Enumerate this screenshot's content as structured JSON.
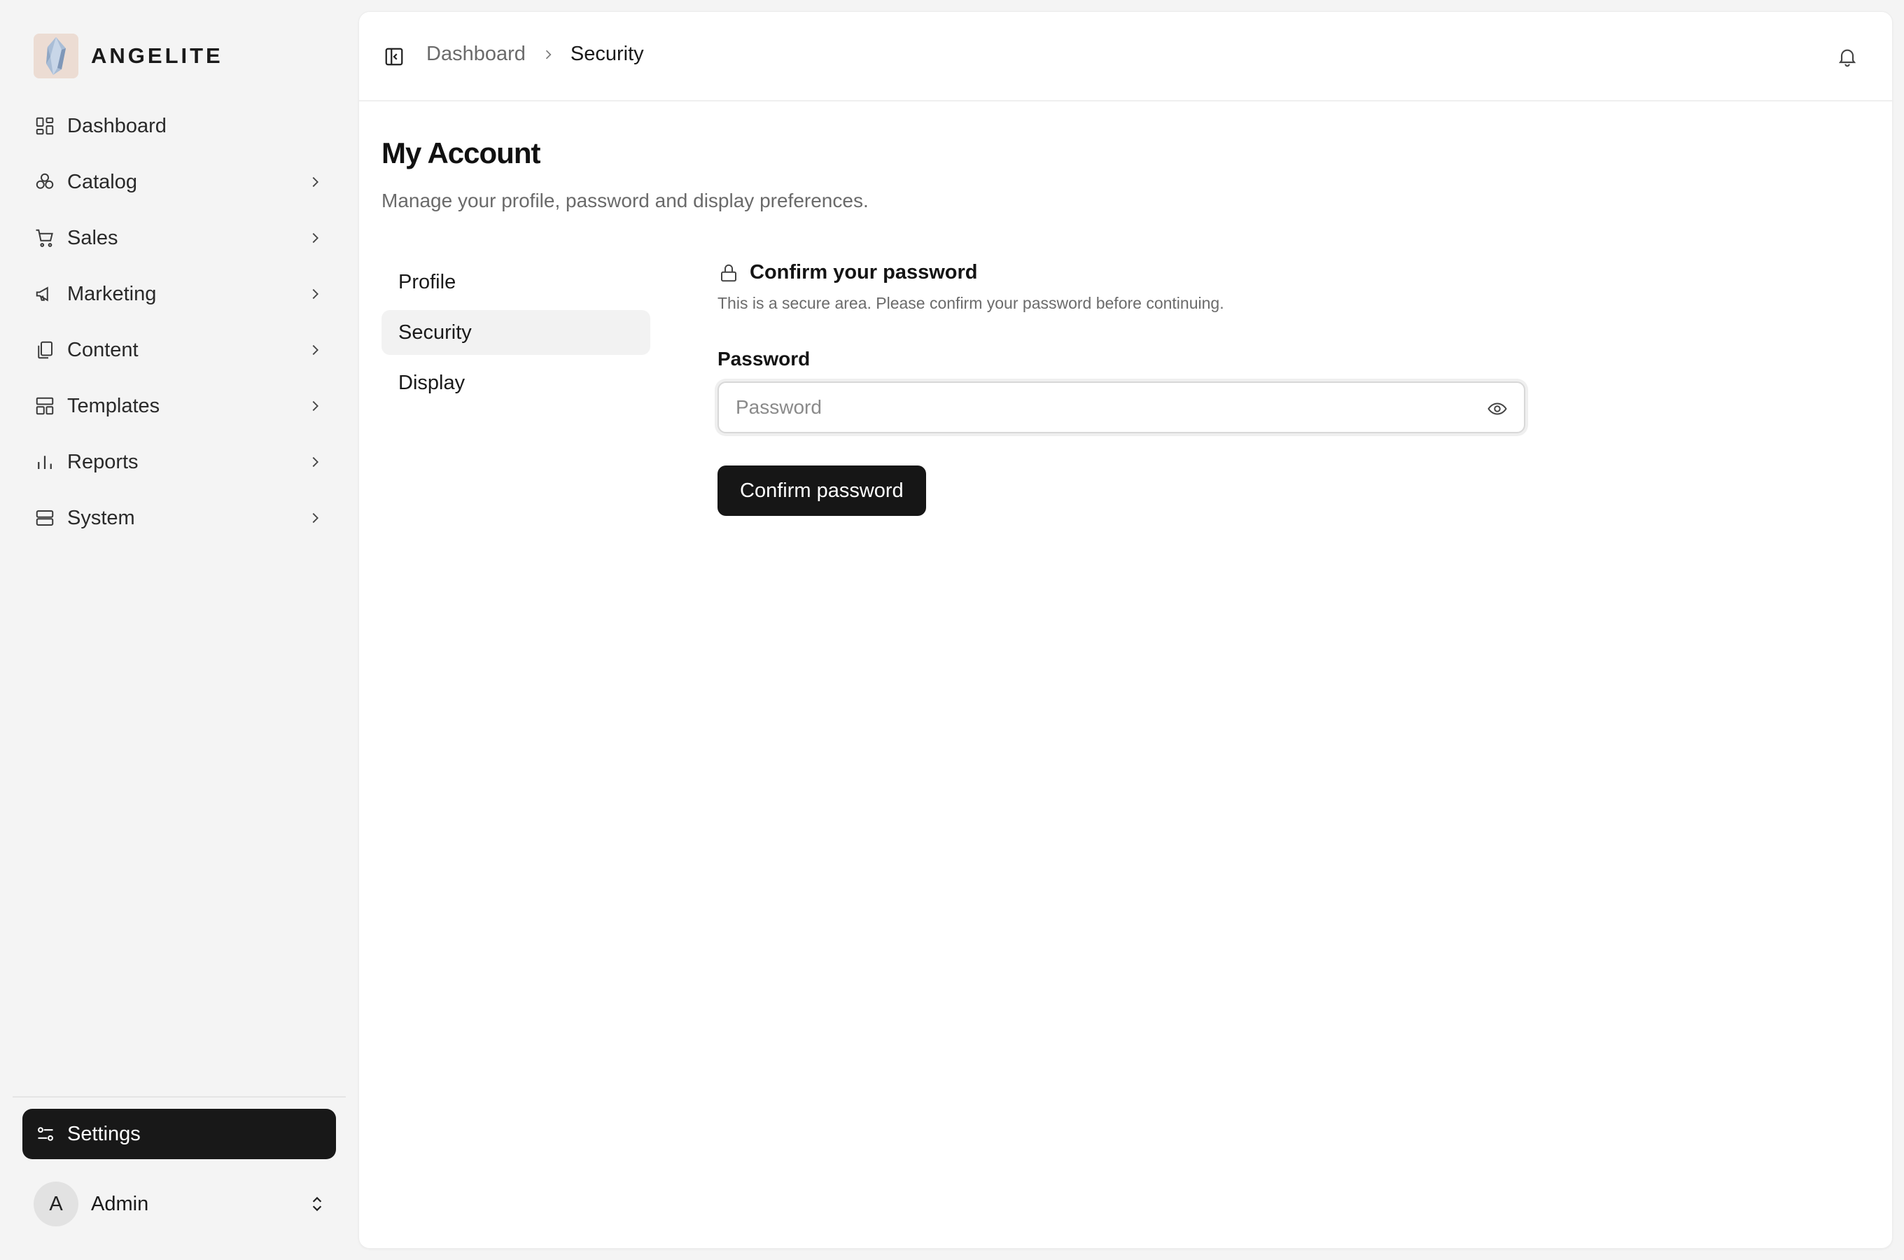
{
  "brand": {
    "name": "ANGELITE",
    "logo_icon": "crystal-logo"
  },
  "sidebar": {
    "items": [
      {
        "label": "Dashboard",
        "icon": "dashboard-icon",
        "has_children": false
      },
      {
        "label": "Catalog",
        "icon": "catalog-icon",
        "has_children": true
      },
      {
        "label": "Sales",
        "icon": "cart-icon",
        "has_children": true
      },
      {
        "label": "Marketing",
        "icon": "megaphone-icon",
        "has_children": true
      },
      {
        "label": "Content",
        "icon": "documents-icon",
        "has_children": true
      },
      {
        "label": "Templates",
        "icon": "layout-icon",
        "has_children": true
      },
      {
        "label": "Reports",
        "icon": "bar-chart-icon",
        "has_children": true
      },
      {
        "label": "System",
        "icon": "server-icon",
        "has_children": true
      }
    ],
    "settings_label": "Settings",
    "user": {
      "initial": "A",
      "name": "Admin"
    }
  },
  "topbar": {
    "breadcrumb": {
      "parent": "Dashboard",
      "current": "Security"
    }
  },
  "page": {
    "title": "My Account",
    "subtitle": "Manage your profile, password and display preferences."
  },
  "subnav": {
    "items": [
      "Profile",
      "Security",
      "Display"
    ],
    "active": "Security"
  },
  "security": {
    "title": "Confirm your password",
    "description": "This is a secure area. Please confirm your password before continuing.",
    "password_label": "Password",
    "password_placeholder": "Password",
    "password_value": "",
    "confirm_label": "Confirm password"
  },
  "colors": {
    "background": "#f4f4f4",
    "panel": "#ffffff",
    "primary_button": "#161616",
    "active_subnav": "#f2f2f2"
  }
}
